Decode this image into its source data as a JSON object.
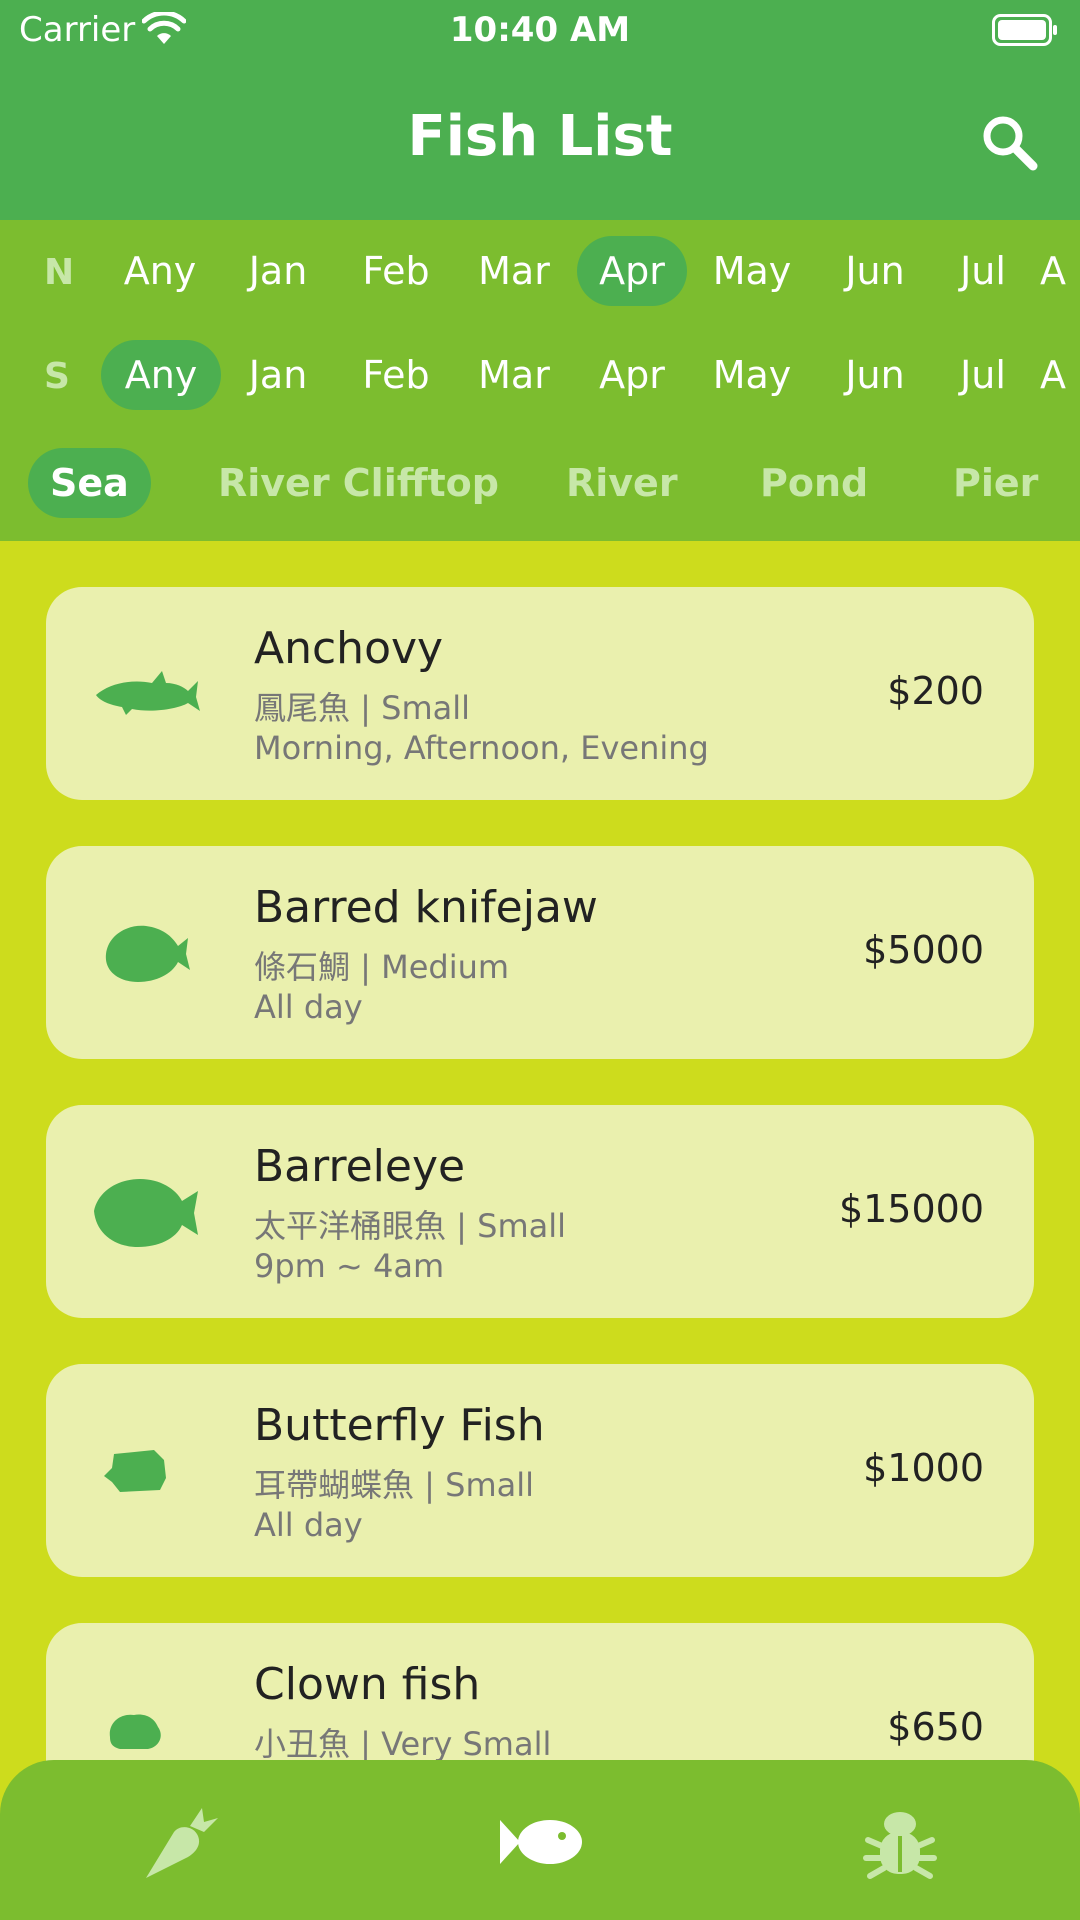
{
  "status_bar": {
    "carrier": "Carrier",
    "time": "10:40 AM"
  },
  "header": {
    "title": "Fish List",
    "search_icon": "search-icon"
  },
  "filters": {
    "north": {
      "label": "N",
      "months": [
        "Any",
        "Jan",
        "Feb",
        "Mar",
        "Apr",
        "May",
        "Jun",
        "Jul",
        "A"
      ],
      "selected": "Apr"
    },
    "south": {
      "label": "S",
      "months": [
        "Any",
        "Jan",
        "Feb",
        "Mar",
        "Apr",
        "May",
        "Jun",
        "Jul",
        "A"
      ],
      "selected": "Any"
    },
    "locations": [
      "Sea",
      "River Clifftop",
      "River",
      "Pond",
      "Pier"
    ],
    "selected_location": "Sea"
  },
  "fish": [
    {
      "name": "Anchovy",
      "sub": "鳳尾魚 | Small",
      "time": "Morning, Afternoon, Evening",
      "price": "$200"
    },
    {
      "name": "Barred knifejaw",
      "sub": "條石鯛 | Medium",
      "time": "All day",
      "price": "$5000"
    },
    {
      "name": "Barreleye",
      "sub": "太平洋桶眼魚 | Small",
      "time": "9pm ~ 4am",
      "price": "$15000"
    },
    {
      "name": "Butterfly Fish",
      "sub": "耳帶蝴蝶魚 | Small",
      "time": "All day",
      "price": "$1000"
    },
    {
      "name": "Clown fish",
      "sub": "小丑魚 | Very Small",
      "time": "",
      "price": "$650"
    }
  ],
  "bottom_nav": {
    "items": [
      "carrot-icon",
      "fish-icon",
      "bug-icon"
    ],
    "active": "fish-icon"
  },
  "colors": {
    "primary": "#4caf50",
    "filter_bg": "#7cbd2f",
    "page_bg": "#cddc1d",
    "card_bg": "#eaf0ae"
  }
}
